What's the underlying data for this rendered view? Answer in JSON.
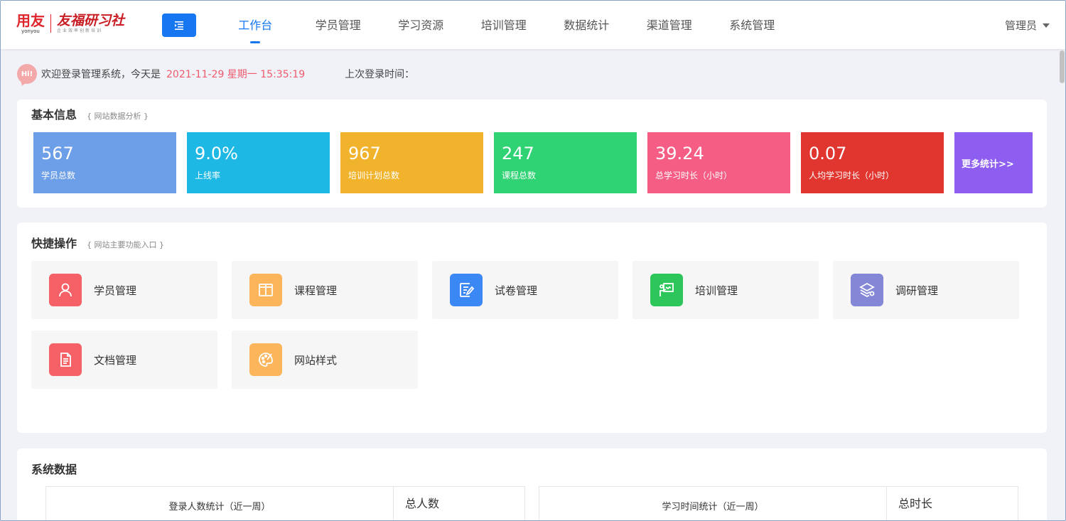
{
  "header": {
    "logo": {
      "brand_main": "用友",
      "brand_sub": "yonyou",
      "org_main": "友福研习社",
      "org_sub": "企业效率创新培训"
    },
    "nav": [
      {
        "label": "工作台",
        "active": true
      },
      {
        "label": "学员管理",
        "active": false
      },
      {
        "label": "学习资源",
        "active": false
      },
      {
        "label": "培训管理",
        "active": false
      },
      {
        "label": "数据统计",
        "active": false
      },
      {
        "label": "渠道管理",
        "active": false
      },
      {
        "label": "系统管理",
        "active": false
      }
    ],
    "user": "管理员",
    "accent": "#1677f0"
  },
  "welcome": {
    "icon_text": "Hi!",
    "prefix": "欢迎登录管理系统，今天是",
    "datetime": "2021-11-29 星期一 15:35:19",
    "last_login_label": "上次登录时间："
  },
  "basic_info": {
    "title": "基本信息",
    "subtitle": "{ 网站数据分析 }",
    "stats": [
      {
        "value": "567",
        "label": "学员总数",
        "color": "#6d9ee8"
      },
      {
        "value": "9.0%",
        "label": "上线率",
        "color": "#1db8e4"
      },
      {
        "value": "967",
        "label": "培训计划总数",
        "color": "#f1b32b"
      },
      {
        "value": "247",
        "label": "课程总数",
        "color": "#2fd374"
      },
      {
        "value": "39.24",
        "label": "总学习时长（小时）",
        "color": "#f55d84"
      },
      {
        "value": "0.07",
        "label": "人均学习时长（小时）",
        "color": "#e13630"
      }
    ],
    "more": {
      "label": "更多统计>>",
      "color": "#8d5ef0"
    }
  },
  "shortcuts": {
    "title": "快捷操作",
    "subtitle": "{ 网站主要功能入口 }",
    "items": [
      {
        "label": "学员管理",
        "icon": "user-icon",
        "color": "#f56167"
      },
      {
        "label": "课程管理",
        "icon": "book-icon",
        "color": "#fdb55c"
      },
      {
        "label": "试卷管理",
        "icon": "exam-edit-icon",
        "color": "#3b87f4"
      },
      {
        "label": "培训管理",
        "icon": "training-board-icon",
        "color": "#2cc65a"
      },
      {
        "label": "调研管理",
        "icon": "survey-layers-icon",
        "color": "#8486d6"
      },
      {
        "label": "文档管理",
        "icon": "document-icon",
        "color": "#f56167"
      },
      {
        "label": "网站样式",
        "icon": "palette-icon",
        "color": "#fdb55c"
      }
    ]
  },
  "system_data": {
    "title": "系统数据",
    "tables": [
      {
        "title": "登录人数统计（近一周）",
        "total_label": "总人数"
      },
      {
        "title": "学习时间统计（近一周）",
        "total_label": "总时长"
      }
    ]
  }
}
